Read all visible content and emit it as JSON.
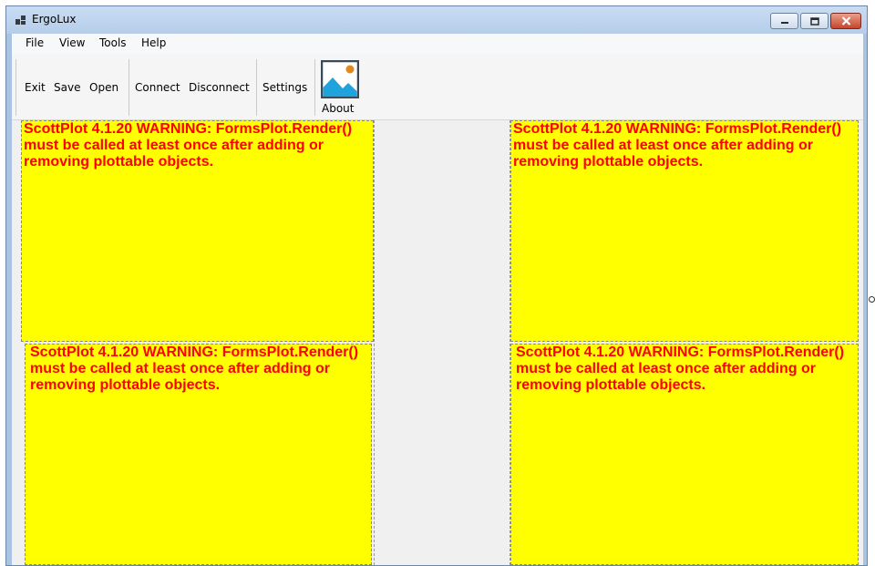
{
  "window": {
    "title": "ErgoLux"
  },
  "menu": {
    "items": [
      "File",
      "View",
      "Tools",
      "Help"
    ]
  },
  "toolbar": {
    "exit_label": "Exit",
    "save_label": "Save",
    "open_label": "Open",
    "connect_label": "Connect",
    "disconnect_label": "Disconnect",
    "settings_label": "Settings",
    "about_label": "About",
    "about_icon": "image-icon"
  },
  "plots": {
    "warning": "ScottPlot 4.1.20 WARNING: FormsPlot.Render() must be called at least once after adding or removing plottable objects."
  },
  "colors": {
    "plot_background": "#ffff00",
    "warning_text": "#ff0000"
  }
}
